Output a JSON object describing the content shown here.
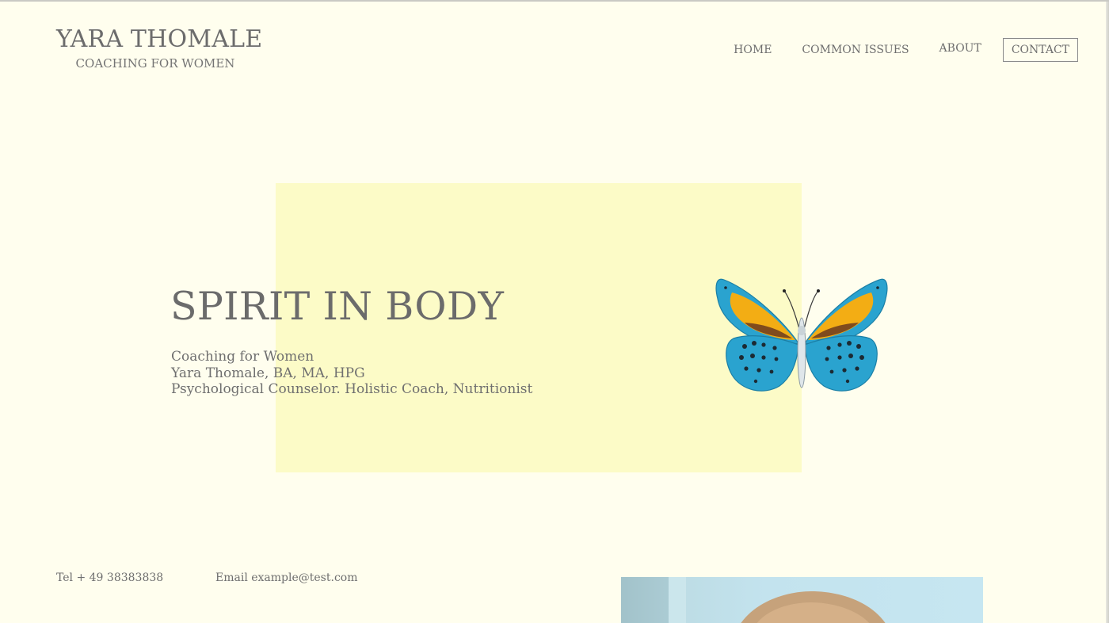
{
  "brand": {
    "name": "YARA THOMALE",
    "tagline": "COACHING FOR WOMEN"
  },
  "nav": {
    "items": [
      "HOME",
      "COMMON ISSUES",
      "ABOUT",
      "CONTACT"
    ]
  },
  "hero": {
    "title": "SPIRIT IN BODY",
    "lines": [
      "Coaching for Women",
      "Yara Thomale, BA, MA, HPG",
      "Psychological Counselor. Holistic Coach, Nutritionist"
    ],
    "image": "butterfly-illustration"
  },
  "contact": {
    "tel": "Tel + 49 38383838",
    "email": "Email example@test.com"
  },
  "portrait": {
    "image": "portrait-photo"
  },
  "colors": {
    "background": "#fffeee",
    "accent_box": "#fcfbc7",
    "text": "#6f6f6f",
    "butterfly_blue": "#2aa3cf",
    "butterfly_orange": "#f3ad14"
  }
}
